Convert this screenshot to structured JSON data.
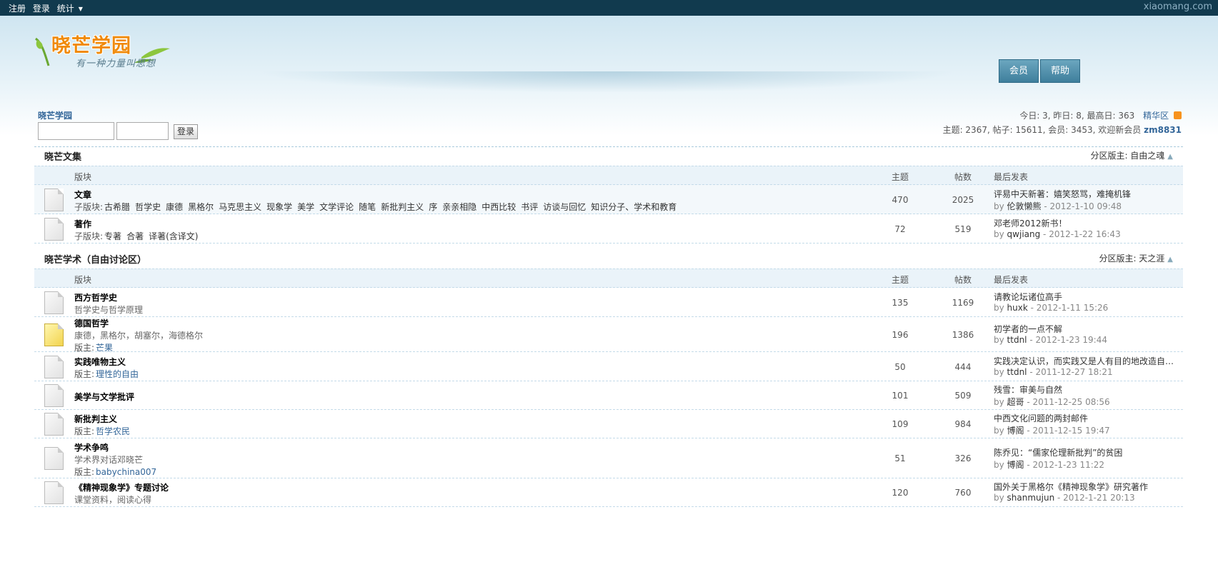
{
  "topbar": {
    "register": "注册",
    "login": "登录",
    "stats": "统计",
    "site": "xiaomang.com"
  },
  "logo": {
    "title": "晓芒学园",
    "slogan": "有一种力量叫思想"
  },
  "nav": {
    "member": "会员",
    "help": "帮助"
  },
  "breadcrumb": "晓芒学园",
  "login": {
    "username_value": "",
    "password_value": "",
    "button": "登录"
  },
  "stats": {
    "line1": "今日: 3, 昨日: 8, 最高日: 363",
    "digest": "精华区",
    "line2_prefix": "主题: 2367, 帖子: 15611, 会员: 3453, 欢迎新会员",
    "newest_member": "zm8831"
  },
  "columns": {
    "forum": "版块",
    "topics": "主题",
    "posts": "帖数",
    "last_post": "最后发表"
  },
  "sections": [
    {
      "title": "晓芒文集",
      "moderator": "分区版主: 自由之魂",
      "forums": [
        {
          "name": "文章",
          "subforum_label": "子版块:",
          "subforums": [
            "古希腊",
            "哲学史",
            "康德",
            "黑格尔",
            "马克思主义",
            "现象学",
            "美学",
            "文学评论",
            "随笔",
            "新批判主义",
            "序",
            "亲亲相隐",
            "中西比较",
            "书评",
            "访谈与回忆",
            "知识分子、学术和教育"
          ],
          "topics": "470",
          "posts": "2025",
          "last_title": "评易中天新著：嬉笑怒骂，难掩机锋",
          "last_user": "伦敦懒熊",
          "last_time": "2012-1-10 09:48"
        },
        {
          "name": "著作",
          "subforum_label": "子版块:",
          "subforums": [
            "专著",
            "合著",
            "译著(含译文)"
          ],
          "topics": "72",
          "posts": "519",
          "last_title": "邓老师2012新书！",
          "last_user": "qwjiang",
          "last_time": "2012-1-22 16:43"
        }
      ]
    },
    {
      "title": "晓芒学术（自由讨论区）",
      "moderator": "分区版主: 天之涯",
      "forums": [
        {
          "name": "西方哲学史",
          "desc": "哲学史与哲学原理",
          "topics": "135",
          "posts": "1169",
          "last_title": "请教论坛诸位高手",
          "last_user": "huxk",
          "last_time": "2012-1-11 15:26"
        },
        {
          "name": "德国哲学",
          "desc": "康德，黑格尔，胡塞尔，海德格尔",
          "mod_label": "版主:",
          "mod": "芒果",
          "topics": "196",
          "posts": "1386",
          "last_title": "初学者的一点不解",
          "last_user": "ttdnl",
          "last_time": "2012-1-23 19:44"
        },
        {
          "name": "实践唯物主义",
          "mod_label": "版主:",
          "mod": "理性的自由",
          "topics": "50",
          "posts": "444",
          "last_title": "实践决定认识，而实践又是人有目的地改造自 ...",
          "last_user": "ttdnl",
          "last_time": "2011-12-27 18:21"
        },
        {
          "name": "美学与文学批评",
          "topics": "101",
          "posts": "509",
          "last_title": "残雪：审美与自然",
          "last_user": "超哥",
          "last_time": "2011-12-25 08:56"
        },
        {
          "name": "新批判主义",
          "mod_label": "版主:",
          "mod": "哲学农民",
          "topics": "109",
          "posts": "984",
          "last_title": "中西文化问题的两封邮件",
          "last_user": "博阁",
          "last_time": "2011-12-15 19:47"
        },
        {
          "name": "学术争鸣",
          "desc": "学术界对话邓晓芒",
          "mod_label": "版主:",
          "mod": "babychina007",
          "topics": "51",
          "posts": "326",
          "last_title": "陈乔见：“儒家伦理新批判”的贫困",
          "last_user": "博阁",
          "last_time": "2012-1-23 11:22"
        },
        {
          "name": "《精神现象学》专题讨论",
          "desc": "课堂资料，阅读心得",
          "topics": "120",
          "posts": "760",
          "last_title": "国外关于黑格尔《精神现象学》研究著作",
          "last_user": "shanmujun",
          "last_time": "2012-1-21 20:13"
        }
      ]
    }
  ],
  "by_label": "by",
  "time_sep": "-"
}
